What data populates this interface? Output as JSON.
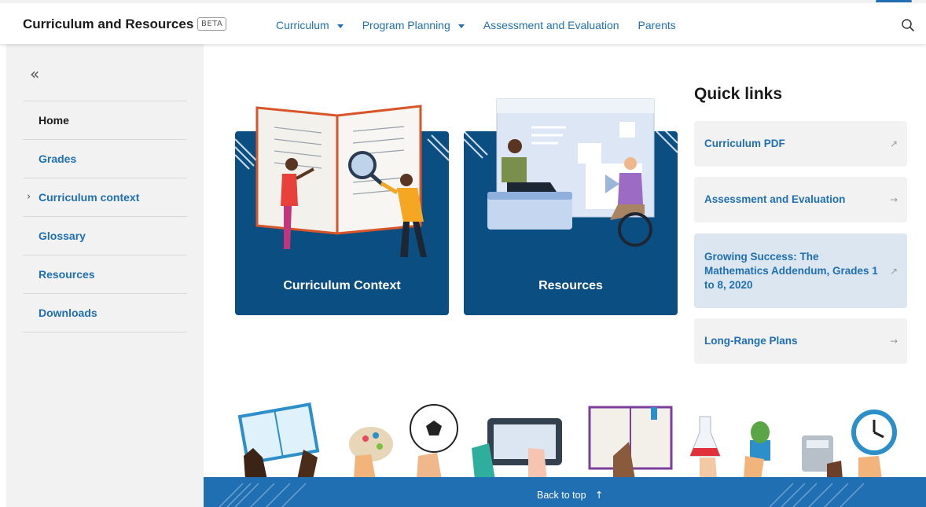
{
  "header": {
    "brand": "Curriculum and Resources",
    "badge": "BETA",
    "nav": [
      {
        "label": "Curriculum",
        "has_caret": true
      },
      {
        "label": "Program Planning",
        "has_caret": true
      },
      {
        "label": "Assessment and Evaluation",
        "has_caret": false
      },
      {
        "label": "Parents",
        "has_caret": false
      }
    ],
    "search_icon": "search-icon"
  },
  "sidebar": {
    "collapse_icon": "double-chevron-left-icon",
    "items": [
      {
        "label": "Home"
      },
      {
        "label": "Grades"
      },
      {
        "label": "Curriculum context",
        "expandable": true
      },
      {
        "label": "Glossary"
      },
      {
        "label": "Resources"
      },
      {
        "label": "Downloads"
      }
    ]
  },
  "cards": [
    {
      "label": "Curriculum Context"
    },
    {
      "label": "Resources"
    }
  ],
  "quick_links": {
    "title": "Quick links",
    "items": [
      {
        "label": "Curriculum PDF",
        "icon": "external-link-icon"
      },
      {
        "label": "Assessment and Evaluation",
        "icon": "arrow-right-icon"
      },
      {
        "label": "Growing Success: The Mathematics Addendum, Grades 1 to 8, 2020",
        "icon": "external-link-icon"
      },
      {
        "label": "Long-Range Plans",
        "icon": "arrow-right-icon"
      }
    ]
  },
  "footer": {
    "back_to_top": "Back to top",
    "back_to_top_icon": "arrow-up-icon"
  },
  "colors": {
    "primary": "#1f6fb2",
    "card_bg": "#0b4f82",
    "sidebar_bg": "#f2f2f2"
  }
}
